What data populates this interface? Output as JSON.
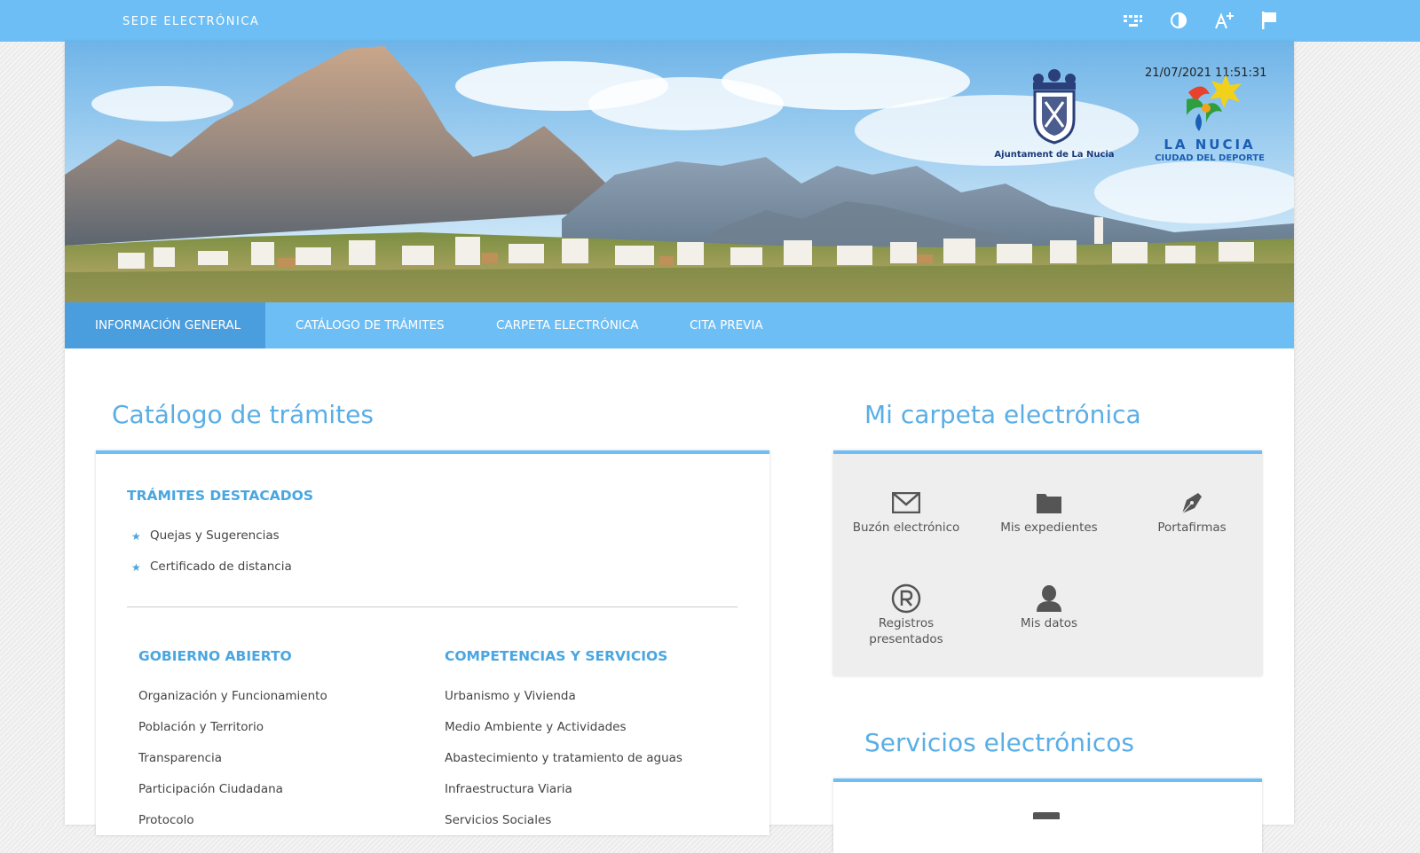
{
  "topbar": {
    "site_title": "SEDE ELECTRÓNICA",
    "icons": [
      "keyboard-icon",
      "contrast-icon",
      "font-size-icon",
      "flag-icon"
    ]
  },
  "header": {
    "datetime": "21/07/2021 11:51:31",
    "escudo_caption": "Ajuntament de La Nucia",
    "logo_name": "LA NUCIA",
    "logo_tagline": "CIUDAD DEL DEPORTE"
  },
  "nav": {
    "items": [
      {
        "label": "INFORMACIÓN GENERAL",
        "active": true
      },
      {
        "label": "CATÁLOGO DE TRÁMITES",
        "active": false
      },
      {
        "label": "CARPETA ELECTRÓNICA",
        "active": false
      },
      {
        "label": "CITA PREVIA",
        "active": false
      }
    ]
  },
  "catalogo": {
    "title": "Catálogo de trámites",
    "destacados_heading": "TRÁMITES DESTACADOS",
    "destacados": [
      "Quejas y Sugerencias",
      "Certificado de distancia"
    ],
    "gobierno": {
      "heading": "GOBIERNO ABIERTO",
      "items": [
        "Organización y Funcionamiento",
        "Población y Territorio",
        "Transparencia",
        "Participación Ciudadana",
        "Protocolo"
      ]
    },
    "competencias": {
      "heading": "COMPETENCIAS Y SERVICIOS",
      "items": [
        "Urbanismo y Vivienda",
        "Medio Ambiente y Actividades",
        "Abastecimiento y tratamiento de aguas",
        "Infraestructura Viaria",
        "Servicios Sociales"
      ]
    }
  },
  "carpeta": {
    "title": "Mi carpeta electrónica",
    "items": [
      {
        "label": "Buzón electrónico",
        "icon": "envelope-icon"
      },
      {
        "label": "Mis expedientes",
        "icon": "folder-icon"
      },
      {
        "label": "Portafirmas",
        "icon": "pen-nib-icon"
      },
      {
        "label": "Registros presentados",
        "icon": "registered-icon"
      },
      {
        "label": "Mis datos",
        "icon": "user-icon"
      }
    ]
  },
  "servicios": {
    "title": "Servicios electrónicos"
  },
  "colors": {
    "accent": "#6dbef4",
    "nav_active": "#4a9ede",
    "heading_blue": "#4aa6e0"
  }
}
